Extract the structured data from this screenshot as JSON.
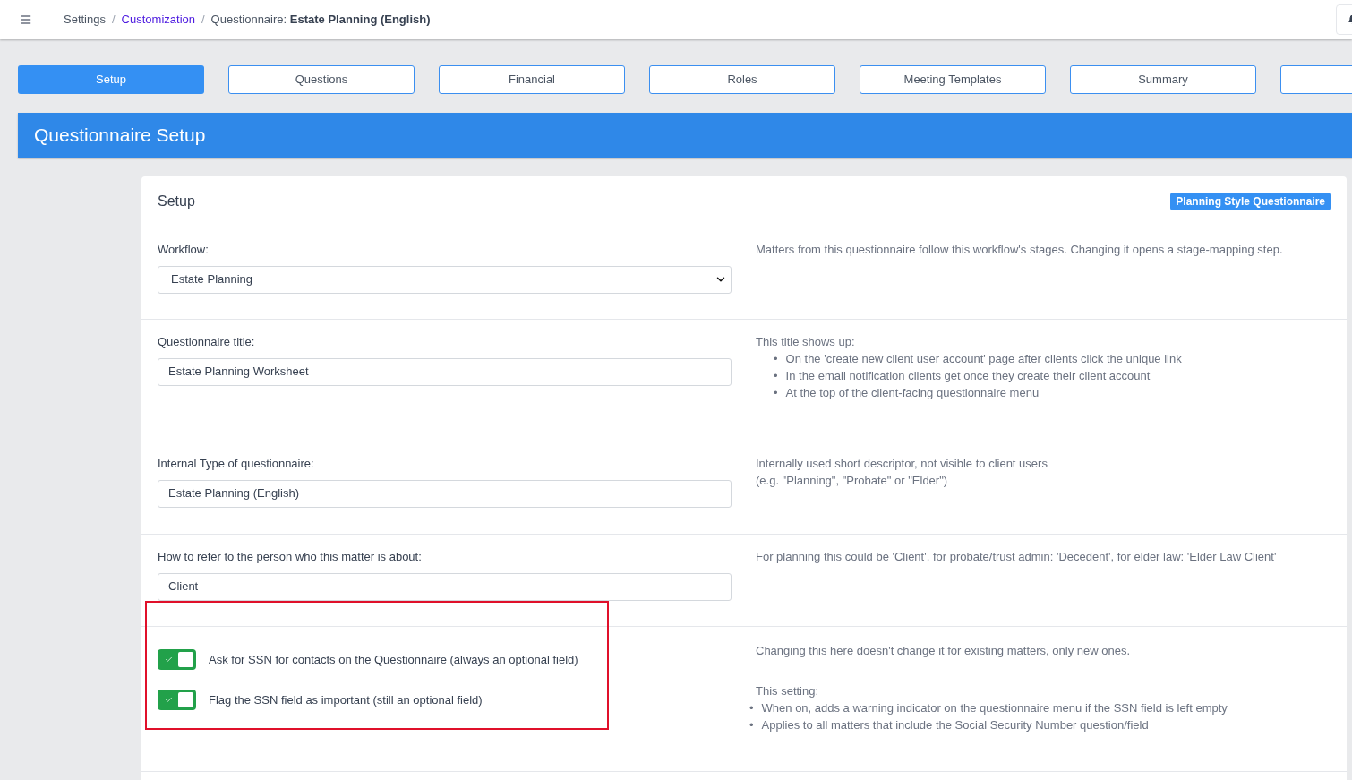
{
  "breadcrumb": {
    "items": [
      {
        "label": "Settings",
        "kind": "plain"
      },
      {
        "label": "Customization",
        "kind": "link"
      }
    ],
    "separator": "/",
    "current_prefix": "Questionnaire:",
    "current": "Estate Planning (English)"
  },
  "tabs": [
    {
      "label": "Setup",
      "selected": true
    },
    {
      "label": "Questions",
      "selected": false
    },
    {
      "label": "Financial",
      "selected": false
    },
    {
      "label": "Roles",
      "selected": false
    },
    {
      "label": "Meeting Templates",
      "selected": false
    },
    {
      "label": "Summary",
      "selected": false
    },
    {
      "selected": false
    }
  ],
  "banner": {
    "title": "Questionnaire Setup"
  },
  "card": {
    "title": "Setup",
    "badge": "Planning Style Questionnaire",
    "rows": [
      {
        "kind": "select",
        "label": "Workflow:",
        "value": "Estate Planning",
        "help": [
          {
            "kind": "text",
            "text": "Matters from this questionnaire follow this workflow's stages. Changing it opens a stage-mapping step."
          }
        ]
      },
      {
        "kind": "input",
        "label": "Questionnaire title:",
        "value": "Estate Planning Worksheet",
        "help": [
          {
            "kind": "text",
            "text": "This title shows up:"
          },
          {
            "kind": "list",
            "marker": "•",
            "items": [
              "On the 'create new client user account' page after clients click the unique link",
              "In the email notification clients get once they create their client account",
              "At the top of the client-facing questionnaire menu"
            ]
          }
        ]
      },
      {
        "kind": "input",
        "label": "Internal Type of questionnaire:",
        "value": "Estate Planning (English)",
        "help": [
          {
            "kind": "text",
            "text": "Internally used short descriptor, not visible to client users"
          },
          {
            "kind": "text",
            "text": "(e.g. \"Planning\", \"Probate\" or \"Elder\")"
          }
        ]
      },
      {
        "kind": "input",
        "label": "How to refer to the person who this matter is about:",
        "value": "Client",
        "help": [
          {
            "kind": "text",
            "text": "For planning this could be 'Client', for probate/trust admin: 'Decedent', for elder law: 'Elder Law Client'"
          }
        ]
      },
      {
        "kind": "toggles",
        "highlighted": true,
        "toggles": [
          {
            "label": "Ask for SSN for contacts on the Questionnaire (always an optional field)",
            "on": true
          },
          {
            "label": "Flag the SSN field as important (still an optional field)",
            "on": true
          }
        ],
        "help": [
          {
            "kind": "text",
            "text": "Changing this here doesn't change it for existing matters, only new ones."
          },
          {
            "kind": "gap"
          },
          {
            "kind": "text",
            "text": "This setting:"
          },
          {
            "kind": "hanging_list",
            "marker": "•",
            "items": [
              "When on, adds a warning indicator on the questionnaire menu if the SSN field is left empty",
              "Applies to all matters that include the Social Security Number question/field"
            ]
          }
        ]
      }
    ]
  }
}
